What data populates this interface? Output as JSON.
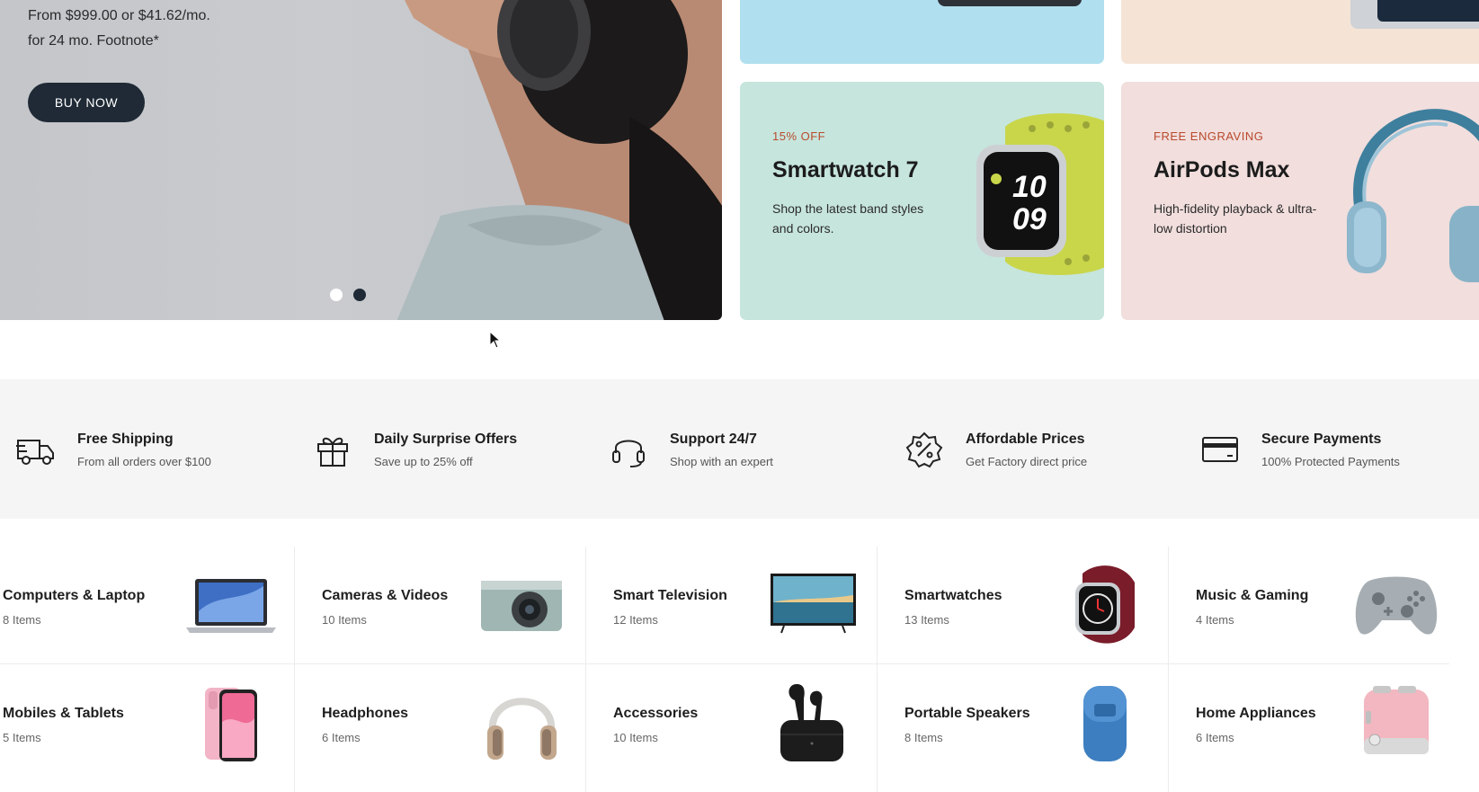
{
  "hero": {
    "line1": "From $999.00 or $41.62/mo.",
    "line2": "for 24 mo. Footnote*",
    "button_label": "BUY NOW",
    "active_slide": 2,
    "slide_count": 2
  },
  "promos": {
    "watch": {
      "eyebrow": "15% OFF",
      "title": "Smartwatch 7",
      "desc": "Shop the latest band styles and colors."
    },
    "airpods": {
      "eyebrow": "FREE ENGRAVING",
      "title": "AirPods Max",
      "desc": "High-fidelity playback & ultra-low distortion"
    }
  },
  "features": [
    {
      "icon": "truck-icon",
      "title": "Free Shipping",
      "sub": "From all orders over $100"
    },
    {
      "icon": "gift-icon",
      "title": "Daily Surprise Offers",
      "sub": "Save up to 25% off"
    },
    {
      "icon": "headset-icon",
      "title": "Support 24/7",
      "sub": "Shop with an expert"
    },
    {
      "icon": "discount-badge-icon",
      "title": "Affordable Prices",
      "sub": "Get Factory direct price"
    },
    {
      "icon": "credit-card-icon",
      "title": "Secure Payments",
      "sub": "100% Protected Payments"
    }
  ],
  "categories": [
    {
      "name": "Computers & Laptop",
      "count": "8 Items",
      "icon": "laptop-image"
    },
    {
      "name": "Cameras & Videos",
      "count": "10 Items",
      "icon": "camera-image"
    },
    {
      "name": "Smart Television",
      "count": "12 Items",
      "icon": "tv-image"
    },
    {
      "name": "Smartwatches",
      "count": "13 Items",
      "icon": "watch-image"
    },
    {
      "name": "Music & Gaming",
      "count": "4 Items",
      "icon": "gamepad-image"
    },
    {
      "name": "Mobiles & Tablets",
      "count": "5 Items",
      "icon": "phone-image"
    },
    {
      "name": "Headphones",
      "count": "6 Items",
      "icon": "headphones-image"
    },
    {
      "name": "Accessories",
      "count": "10 Items",
      "icon": "earbuds-image"
    },
    {
      "name": "Portable Speakers",
      "count": "8 Items",
      "icon": "speaker-image"
    },
    {
      "name": "Home Appliances",
      "count": "6 Items",
      "icon": "toaster-image"
    }
  ],
  "colors": {
    "dark_button": "#1f2a36",
    "eyebrow_accent": "#b94a2c",
    "watch_card_bg": "#c6e5dd",
    "airpods_card_bg": "#f1dedd",
    "feature_band_bg": "#f4f5f4"
  }
}
